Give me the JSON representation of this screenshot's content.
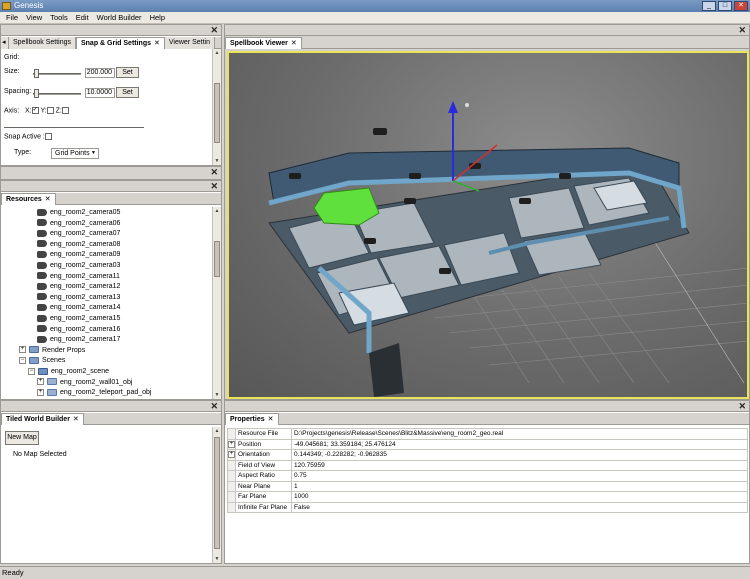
{
  "window": {
    "title": "Genesis",
    "buttons": [
      "_",
      "□",
      "✕"
    ]
  },
  "menu": [
    "File",
    "View",
    "Tools",
    "Edit",
    "World Builder",
    "Help"
  ],
  "top_left": {
    "tabs": [
      {
        "label": "Spellbook Settings",
        "active": false
      },
      {
        "label": "Snap & Grid Settings",
        "active": true
      },
      {
        "label": "Viewer Settin",
        "active": false
      }
    ],
    "close_glyph": "✕",
    "grid_label": "Grid:",
    "size_label": "Size:",
    "size_value": "200.000",
    "spacing_label": "Spacing:",
    "spacing_value": "10.0000",
    "set_label": "Set",
    "axis_label": "Axis:",
    "axis_x": "X:",
    "axis_y": "Y:",
    "axis_z": "Z:",
    "axis_checked": {
      "x": true,
      "y": false,
      "z": false
    },
    "snap_active_label": "Snap Active :",
    "snap_active_checked": false,
    "type_label": "Type:",
    "type_value": "Grid Points"
  },
  "resources": {
    "tab": "Resources",
    "items": [
      {
        "label": "eng_room2_camera05",
        "icon": "camera-icon",
        "depth": 4,
        "expander": ""
      },
      {
        "label": "eng_room2_camera06",
        "icon": "camera-icon",
        "depth": 4,
        "expander": ""
      },
      {
        "label": "eng_room2_camera07",
        "icon": "camera-icon",
        "depth": 4,
        "expander": ""
      },
      {
        "label": "eng_room2_camera08",
        "icon": "camera-icon",
        "depth": 4,
        "expander": ""
      },
      {
        "label": "eng_room2_camera09",
        "icon": "camera-icon",
        "depth": 4,
        "expander": ""
      },
      {
        "label": "eng_room2_camera03",
        "icon": "camera-icon",
        "depth": 4,
        "expander": ""
      },
      {
        "label": "eng_room2_camera11",
        "icon": "camera-icon",
        "depth": 4,
        "expander": ""
      },
      {
        "label": "eng_room2_camera12",
        "icon": "camera-icon",
        "depth": 4,
        "expander": ""
      },
      {
        "label": "eng_room2_camera13",
        "icon": "camera-icon",
        "depth": 4,
        "expander": ""
      },
      {
        "label": "eng_room2_camera14",
        "icon": "camera-icon",
        "depth": 4,
        "expander": ""
      },
      {
        "label": "eng_room2_camera15",
        "icon": "camera-icon",
        "depth": 4,
        "expander": ""
      },
      {
        "label": "eng_room2_camera16",
        "icon": "camera-icon",
        "depth": 4,
        "expander": ""
      },
      {
        "label": "eng_room2_camera17",
        "icon": "camera-icon",
        "depth": 4,
        "expander": ""
      },
      {
        "label": "Render Props",
        "icon": "folder-icon",
        "depth": 2,
        "expander": "+"
      },
      {
        "label": "Scenes",
        "icon": "folder-icon",
        "depth": 2,
        "expander": "−"
      },
      {
        "label": "eng_room2_scene",
        "icon": "scene-icon",
        "depth": 3,
        "expander": "−"
      },
      {
        "label": "eng_room2_wall01_obj",
        "icon": "object-icon",
        "depth": 4,
        "expander": "+"
      },
      {
        "label": "eng_room2_teleport_pad_obj",
        "icon": "object-icon",
        "depth": 4,
        "expander": "+"
      }
    ]
  },
  "tiled_world_builder": {
    "tab": "Tiled World Builder",
    "new_map_label": "New Map",
    "status": "No Map Selected"
  },
  "viewer": {
    "tab": "Spellbook Viewer",
    "accent": "#e8e35a"
  },
  "properties": {
    "tab": "Properties",
    "rows": [
      {
        "expander": "",
        "name": "Resource File",
        "value": "D:\\Projects\\genesis\\Release\\Scenes\\Blitz&Massive\\eng_room2_geo.real"
      },
      {
        "expander": "+",
        "name": "Position",
        "value": "-49.045681; 33.359184; 25.476124"
      },
      {
        "expander": "+",
        "name": "Orientation",
        "value": "0.144349; -0.228282; -0.962835"
      },
      {
        "expander": "",
        "name": "Field of View",
        "value": "120.75959"
      },
      {
        "expander": "",
        "name": "Aspect Ratio",
        "value": "0.75"
      },
      {
        "expander": "",
        "name": "Near Plane",
        "value": "1"
      },
      {
        "expander": "",
        "name": "Far Plane",
        "value": "1000"
      },
      {
        "expander": "",
        "name": "Infinite Far Plane",
        "value": "False"
      }
    ]
  },
  "status_bar": {
    "text": "Ready"
  }
}
